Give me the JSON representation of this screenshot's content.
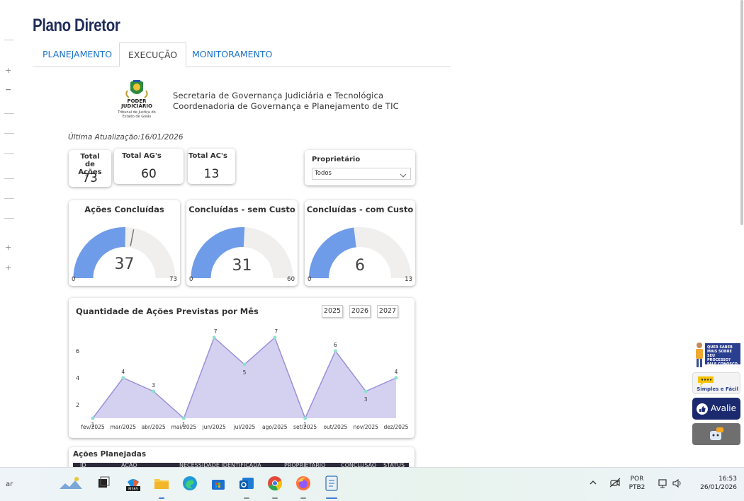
{
  "page": {
    "title": "Plano Diretor"
  },
  "tabs": [
    {
      "label": "PLANEJAMENTO",
      "active": false
    },
    {
      "label": "EXECUÇÃO",
      "active": true
    },
    {
      "label": "MONITORAMENTO",
      "active": false
    }
  ],
  "header": {
    "logo_text": "PODER JUDICIÁRIO",
    "logo_sub": "Tribunal de Justiça do Estado de Goiás",
    "org_line1": "Secretaria de Governança Judiciária e Tecnológica",
    "org_line2": "Coordenadoria de Governança e Planejamento de TIC",
    "last_update": "Última Atualização:16/01/2026"
  },
  "kpis": [
    {
      "label": "Total de Ações",
      "value": "73"
    },
    {
      "label": "Total AG's",
      "value": "60"
    },
    {
      "label": "Total AC's",
      "value": "13"
    }
  ],
  "owner_filter": {
    "label": "Proprietário",
    "value": "Todos"
  },
  "gauges": [
    {
      "title": "Ações Concluídas",
      "value": 37,
      "min": "0",
      "max": 73,
      "target_fraction": 0.94
    },
    {
      "title": "Concluídas - sem Custo",
      "value": 31,
      "min": "0",
      "max": 60
    },
    {
      "title": "Concluídas - com Custo",
      "value": 6,
      "min": "0",
      "max": 13
    }
  ],
  "chart_data": {
    "type": "area",
    "title": "Quantidade de Ações Previstas por Mês",
    "categories": [
      "fev/2025",
      "mar/2025",
      "abr/2025",
      "mai/2025",
      "jun/2025",
      "jul/2025",
      "ago/2025",
      "set/2025",
      "out/2025",
      "nov/2025",
      "dez/2025"
    ],
    "values": [
      1,
      4,
      3,
      1,
      7,
      5,
      7,
      1,
      6,
      3,
      4
    ],
    "y_ticks": [
      "2",
      "4",
      "6"
    ],
    "ylim": [
      1,
      7
    ],
    "year_buttons": [
      "2025",
      "2026",
      "2027"
    ],
    "fill_color": "#d4d1f0",
    "line_color": "#9b8fd9",
    "marker_color": "#8ee0d0"
  },
  "planned_table": {
    "title": "Ações Planejadas",
    "columns": [
      "ID",
      "AÇÃO",
      "NECESSIDADE IDENTIFICADA",
      "PROPRIETÁRIO",
      "CONCLUSÃO",
      "STATUS"
    ]
  },
  "widgets": {
    "process_text": "QUER SABER MAIS SOBRE SEU PROCESSO? FALE CONOSCO",
    "simple_label": "Simples e Fácil",
    "rate_label": "Avalie"
  },
  "taskbar": {
    "search_fragment": "ar",
    "lang_top": "POR",
    "lang_bottom": "PTB2",
    "time": "16:53",
    "date": "26/01/2026",
    "m365_badge": "M365"
  },
  "colors": {
    "gauge_fill": "#6f9ce8",
    "gauge_track": "#f0efee",
    "title": "#1f2d5a",
    "tab_link": "#1a73c9"
  }
}
